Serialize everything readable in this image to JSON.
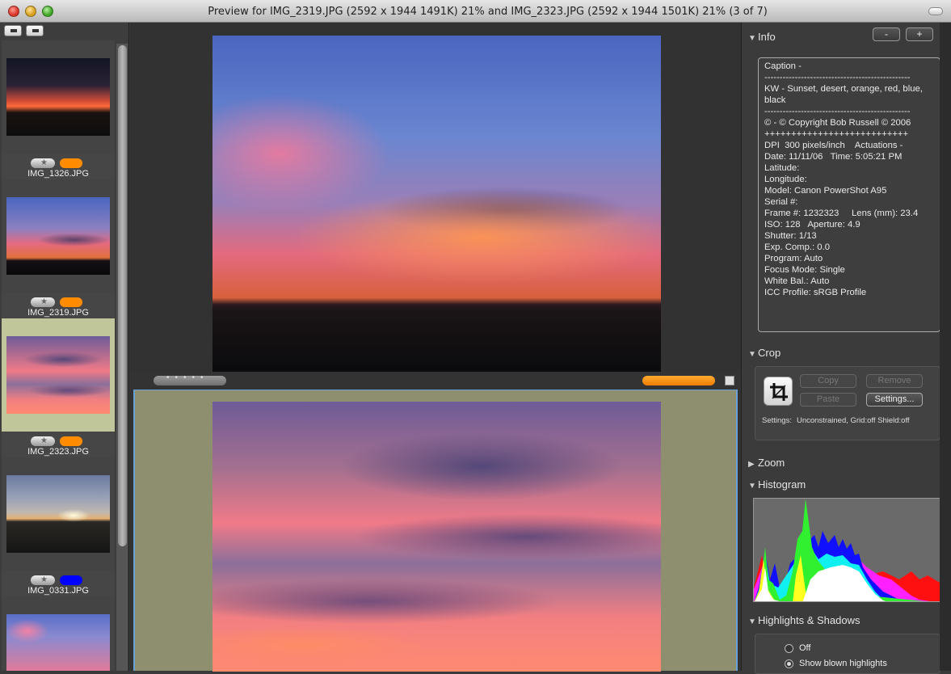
{
  "window": {
    "title": "Preview for IMG_2319.JPG (2592 x 1944 1491K) 21% and IMG_2323.JPG (2592 x 1944 1501K) 21% (3 of 7)"
  },
  "thumbnails": [
    {
      "filename": "IMG_1326.JPG",
      "label_color": "#ff8c00",
      "selected": false
    },
    {
      "filename": "IMG_2319.JPG",
      "label_color": "#ff8c00",
      "selected": false
    },
    {
      "filename": "IMG_2323.JPG",
      "label_color": "#ff8c00",
      "selected": true
    },
    {
      "filename": "IMG_0331.JPG",
      "label_color": "#0000ff",
      "selected": false
    }
  ],
  "info_panel": {
    "title": "Info",
    "minus_label": "-",
    "plus_label": "+",
    "text": "Caption -\n------------------------------------------------\nKW - Sunset, desert, orange, red, blue,\nblack\n------------------------------------------------\n© - © Copyright Bob Russell © 2006\n+++++++++++++++++++++++++++\nDPI  300 pixels/inch    Actuations -\nDate: 11/11/06   Time: 5:05:21 PM\nLatitude:\nLongitude:\nModel: Canon PowerShot A95\nSerial #:\nFrame #: 1232323     Lens (mm): 23.4\nISO: 128   Aperture: 4.9\nShutter: 1/13\nExp. Comp.: 0.0\nProgram: Auto\nFocus Mode: Single\nWhite Bal.: Auto\nICC Profile: sRGB Profile"
  },
  "crop_panel": {
    "title": "Crop",
    "copy_label": "Copy",
    "remove_label": "Remove",
    "paste_label": "Paste",
    "settings_label": "Settings...",
    "settings_caption": "Settings:",
    "settings_value": "Unconstrained, Grid:off Shield:off"
  },
  "zoom_panel": {
    "title": "Zoom"
  },
  "histogram_panel": {
    "title": "Histogram"
  },
  "highlights_panel": {
    "title": "Highlights & Shadows",
    "options": [
      {
        "label": "Off",
        "selected": false
      },
      {
        "label": "Show blown highlights",
        "selected": true
      }
    ]
  },
  "colors": {
    "selection_bg": "#c0c59a",
    "accent_orange": "#ff8c00"
  }
}
